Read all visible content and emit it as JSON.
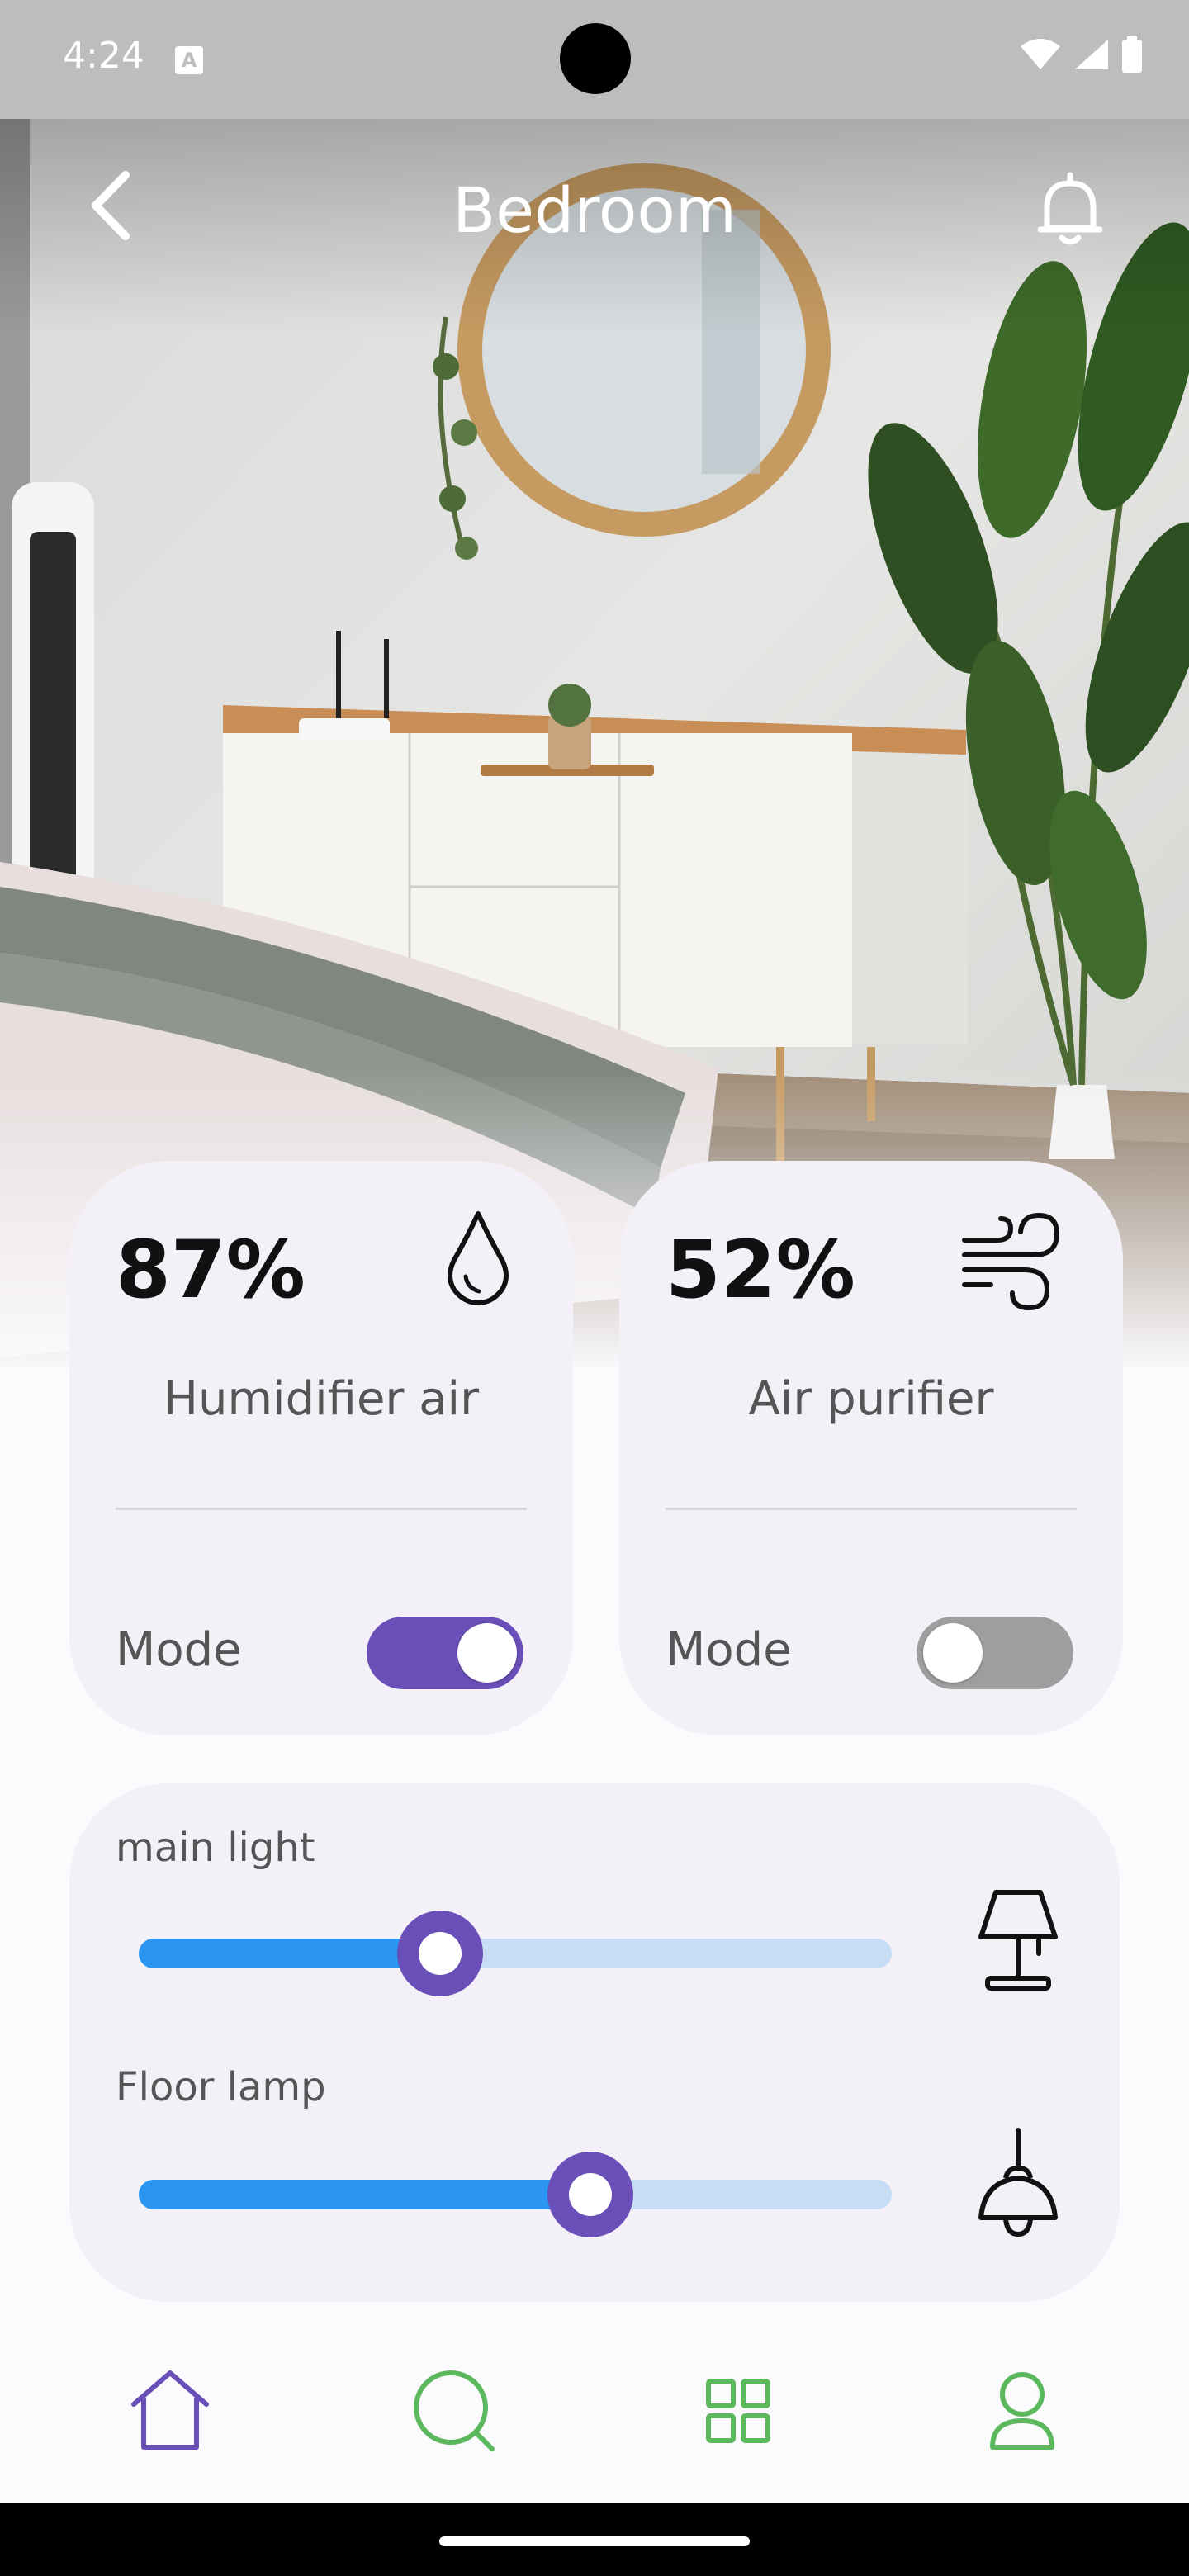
{
  "status_bar": {
    "time": "4:24"
  },
  "header": {
    "title": "Bedroom"
  },
  "cards": [
    {
      "value": "87%",
      "label": "Humidifier air",
      "mode_label": "Mode",
      "mode_on": true,
      "icon": "water-drop-icon"
    },
    {
      "value": "52%",
      "label": "Air purifier",
      "mode_label": "Mode",
      "mode_on": false,
      "icon": "wind-icon"
    }
  ],
  "lights": [
    {
      "label": "main light",
      "level_percent": 40,
      "icon": "table-lamp-icon"
    },
    {
      "label": "Floor lamp",
      "level_percent": 60,
      "icon": "pendant-lamp-icon"
    }
  ],
  "bottom_nav": [
    {
      "icon": "home-icon",
      "active": true
    },
    {
      "icon": "search-icon",
      "active": false
    },
    {
      "icon": "grid-icon",
      "active": false
    },
    {
      "icon": "profile-icon",
      "active": false
    }
  ],
  "colors": {
    "accent": "#6a4fb8",
    "slider_fill": "#2a96f1",
    "slider_track": "#c7ddf6",
    "nav_inactive": "#5cb85c",
    "card_bg": "#f3f0f8"
  }
}
